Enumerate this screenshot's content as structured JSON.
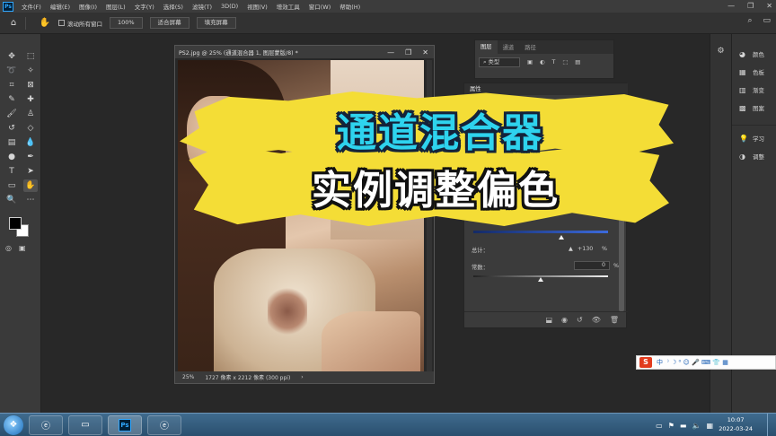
{
  "app": {
    "logo": "Ps"
  },
  "menu": [
    "文件(F)",
    "编辑(E)",
    "图像(I)",
    "图层(L)",
    "文字(Y)",
    "选择(S)",
    "滤镜(T)",
    "3D(D)",
    "视图(V)",
    "增效工具",
    "窗口(W)",
    "帮助(H)"
  ],
  "window_controls": {
    "min": "—",
    "max": "❐",
    "close": "✕"
  },
  "options": {
    "scroll_all_windows": "滚动所有窗口",
    "zoom_value": "100%",
    "fit_screen": "适合屏幕",
    "fill_screen": "填充屏幕"
  },
  "document": {
    "title": "PS2.jpg @ 25% (通道混合器 1, 图层蒙版/8) *",
    "zoom": "25%",
    "info": "1727 像素 x 2212 像素 (300 ppi)",
    "arrow": "›"
  },
  "layers_panel": {
    "tabs": [
      "图层",
      "通道",
      "路径"
    ],
    "kind_label": "类型"
  },
  "properties_panel": {
    "tab": "属性",
    "total_label": "总计：",
    "total_warning": "▲",
    "total_value": "+130",
    "total_unit": "%",
    "constant_label": "常数：",
    "constant_value": "0",
    "constant_unit": "%",
    "blue_slider_fraction": 0.65,
    "constant_slider_fraction": 0.5
  },
  "right_panel": {
    "items": [
      {
        "icon": "palette-icon",
        "label": "颜色"
      },
      {
        "icon": "swatches-icon",
        "label": "色板"
      },
      {
        "icon": "gradient-icon",
        "label": "渐变"
      },
      {
        "icon": "pattern-icon",
        "label": "图案"
      },
      {
        "icon": "learn-icon",
        "label": "学习"
      },
      {
        "icon": "adjust-icon",
        "label": "调整"
      }
    ]
  },
  "overlay": {
    "line1": "通道混合器",
    "line2": "实例调整偏色",
    "line1_color": "#2ed3ee",
    "line2_color": "#ffffff",
    "brush_color": "#f4dd36"
  },
  "ime": {
    "logo": "S",
    "mode": "中",
    "icons": "⁾ ☽ ⁰ ☺ 🎤 ⌨ 👕 ▦"
  },
  "taskbar": {
    "ps_label": "Ps",
    "time": "10:07",
    "date": "2022-03-24"
  }
}
